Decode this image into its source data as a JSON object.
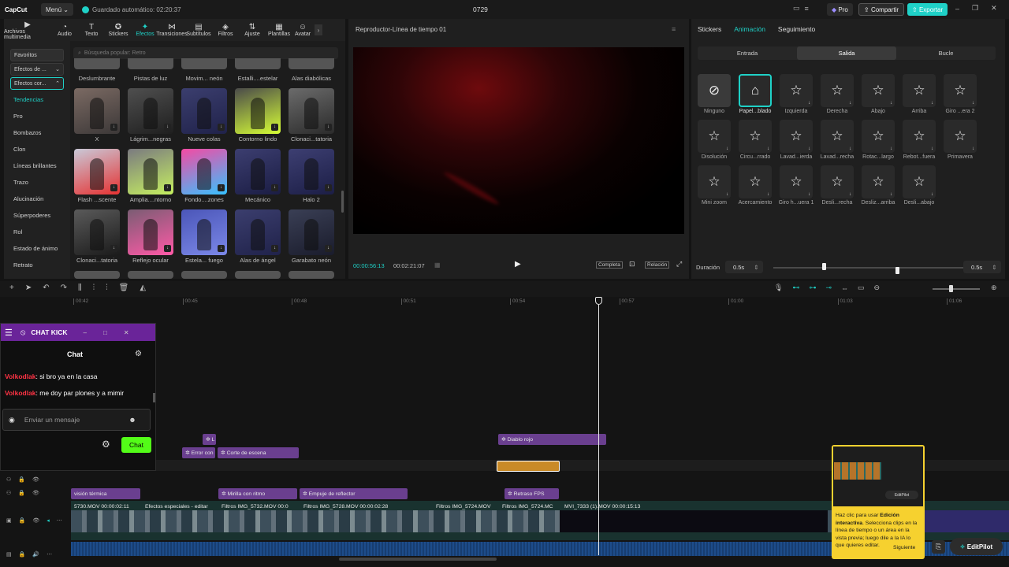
{
  "topbar": {
    "logo": "CapCut",
    "menu": "Menú",
    "autosave": "Guardado automático: 02:20:37",
    "project": "0729",
    "pro": "Pro",
    "share": "Compartir",
    "export": "Exportar"
  },
  "toolbar": [
    {
      "icon": "media-icon",
      "label": "Archivos multimedia"
    },
    {
      "icon": "audio-icon",
      "label": "Audio"
    },
    {
      "icon": "text-icon",
      "label": "Texto"
    },
    {
      "icon": "sticker-icon",
      "label": "Stickers"
    },
    {
      "icon": "effects-icon",
      "label": "Efectos"
    },
    {
      "icon": "transitions-icon",
      "label": "Transiciones"
    },
    {
      "icon": "subtitles-icon",
      "label": "Subtítulos"
    },
    {
      "icon": "filters-icon",
      "label": "Filtros"
    },
    {
      "icon": "adjust-icon",
      "label": "Ajuste"
    },
    {
      "icon": "templates-icon",
      "label": "Plantillas"
    },
    {
      "icon": "avatar-icon",
      "label": "Avatar"
    }
  ],
  "categories": {
    "favorites": "Favoritos",
    "drop1": "Efectos de ...",
    "drop2": "Efectos cor...",
    "items": [
      "Tendencias",
      "Pro",
      "Bombazos",
      "Clon",
      "Líneas brillantes",
      "Trazo",
      "Alucinación",
      "Súperpoderes",
      "Rol",
      "Estado de ánimo",
      "Retrato"
    ]
  },
  "search": {
    "placeholder": "Búsqueda popular: Retro"
  },
  "effects_row0": [
    "Deslumbrante",
    "Pistas de luz",
    "Movim... neón",
    "Estalli....estelar",
    "Alas diabólicas"
  ],
  "effects": [
    "X",
    "Lágrim...negras",
    "Nueve colas",
    "Contorno lindo",
    "Clonaci...tatoria",
    "Flash ...scente",
    "Amplia....ntorno",
    "Fondo....zones",
    "Mecánico",
    "Halo 2",
    "Clonaci...tatoria",
    "Reflejo ocular",
    "Estela... fuego",
    "Alas de ángel",
    "Garabato neón"
  ],
  "player": {
    "title": "Reproductor-Línea de tiempo 01",
    "current": "00:00:56:13",
    "total": "00:02:21:07",
    "full": "Completa",
    "ratio": "Relación"
  },
  "right": {
    "tabs": [
      "Stickers",
      "Animación",
      "Seguimiento"
    ],
    "subtabs": [
      "Entrada",
      "Salida",
      "Bucle"
    ],
    "anims": [
      "Ninguno",
      "Papel...blado",
      "Izquierda",
      "Derecha",
      "Abajo",
      "Arriba",
      "Giro ...era 2",
      "Disolución",
      "Circu...rrado",
      "Lavad...ierda",
      "Lavad...recha",
      "Rotac...largo",
      "Rebot...fuera",
      "Primavera",
      "Mini zoom",
      "Acercamiento",
      "Giro h...uera 1",
      "Desli...recha",
      "Desliz...arriba",
      "Desli...abajo"
    ],
    "duration_label": "Duración",
    "duration": "0.5s",
    "duration2": "0.5s"
  },
  "ruler": [
    "00:42",
    "00:45",
    "00:48",
    "00:51",
    "00:54",
    "00:57",
    "01:00",
    "01:03",
    "01:06"
  ],
  "chat": {
    "title": "CHAT KICK",
    "tab": "Chat",
    "messages": [
      {
        "user": "Volkodlak",
        "text": "si bro ya en la casa"
      },
      {
        "user": "Volkodlak",
        "text": "me doy par plones y a mimir"
      }
    ],
    "placeholder": "Enviar un mensaje",
    "send": "Chat"
  },
  "clips": {
    "l": "L",
    "diablo": "Diablo rojo",
    "error": "Error con",
    "corte": "Corte de escena",
    "vision": "visión térmica",
    "retraso": "Retraso FPS",
    "mirilla": "Mirilla con ritmo",
    "empuje": "Empuje de reflector",
    "v1": "5730.MOV  00:00:02:11",
    "v2": "Efectos especiales - editar",
    "v3": "Filtros  IMG_5732.MOV  00:0",
    "v4": "Filtros  IMG_5728.MOV  00:00:02:28",
    "v5": "Filtros  IMG_5724.MOV",
    "v6": "Filtros  IMG_5724.MC",
    "v7": "MVI_7333 (1).MOV  00:00:15:13"
  },
  "tooltip": {
    "pre": "Haz clic para usar ",
    "bold1": "Edición interactiva",
    "text": ". Selecciona clips en la línea de tiempo o un área en la vista previa; luego dile a la IA lo que quieres editar.",
    "next": "Siguiente",
    "badge": "EditPilot"
  },
  "editpilot": "EditPilot",
  "colors": {
    "accent": "#1fd1c7",
    "clip_purple": "#6a3f8f",
    "clip_orange": "#c98a27",
    "video_teal": "#1e6e6a"
  }
}
